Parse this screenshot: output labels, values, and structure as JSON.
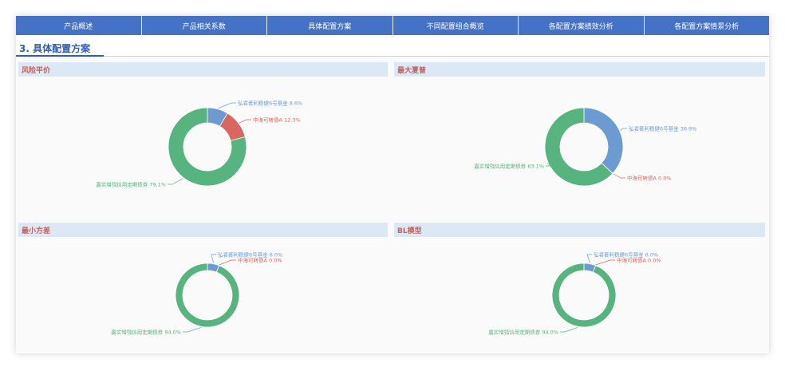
{
  "tabs": [
    "产品概述",
    "产品相关系数",
    "具体配置方案",
    "不同配置组合概览",
    "各配置方案绩效分析",
    "各配置方案情景分析"
  ],
  "section_title": "3. 具体配置方案",
  "panels": [
    {
      "title": "风险平价"
    },
    {
      "title": "最大夏普"
    },
    {
      "title": "最小方差"
    },
    {
      "title": "BL模型"
    }
  ],
  "colors": {
    "fund": "#6b9bd1",
    "cb": "#d9665f",
    "bond": "#58b47e",
    "accent": "#2e5eae",
    "tabbar": "#4472c4"
  },
  "chart_data": [
    {
      "type": "pie",
      "title": "风险平价",
      "slices": [
        {
          "label": "弘君套利稳健6号基金",
          "value": 8.6,
          "text": "弘君套利稳健6号基金 8.6%"
        },
        {
          "label": "中海可转债A",
          "value": 12.3,
          "text": "中海可转债A 12.3%"
        },
        {
          "label": "嘉实增强信用定期债券",
          "value": 79.1,
          "text": "嘉实增强信用定期债券 79.1%"
        }
      ]
    },
    {
      "type": "pie",
      "title": "最大夏普",
      "slices": [
        {
          "label": "弘君套利稳健6号基金",
          "value": 36.9,
          "text": "弘君套利稳健6号基金 36.9%"
        },
        {
          "label": "中海可转债A",
          "value": 0.0,
          "text": "中海可转债A 0.0%"
        },
        {
          "label": "嘉实增强信用定期债券",
          "value": 63.1,
          "text": "嘉实增强信用定期债券 63.1%"
        }
      ]
    },
    {
      "type": "pie",
      "title": "最小方差",
      "slices": [
        {
          "label": "弘君套利稳健6号基金",
          "value": 6.0,
          "text": "弘君套利稳健6号基金 6.0%"
        },
        {
          "label": "中海可转债A",
          "value": 0.0,
          "text": "中海可转债A 0.0%"
        },
        {
          "label": "嘉实增强信用定期债券",
          "value": 94.0,
          "text": "嘉实增强信用定期债券 94.0%"
        }
      ]
    },
    {
      "type": "pie",
      "title": "BL模型",
      "slices": [
        {
          "label": "弘君套利稳健6号基金",
          "value": 6.0,
          "text": "弘君套利稳健6号基金 6.0%"
        },
        {
          "label": "中海可转债A",
          "value": 0.0,
          "text": "中海可转债A 0.0%"
        },
        {
          "label": "嘉实增强信用定期债券",
          "value": 94.0,
          "text": "嘉实增强信用定期债券 94.0%"
        }
      ]
    }
  ]
}
